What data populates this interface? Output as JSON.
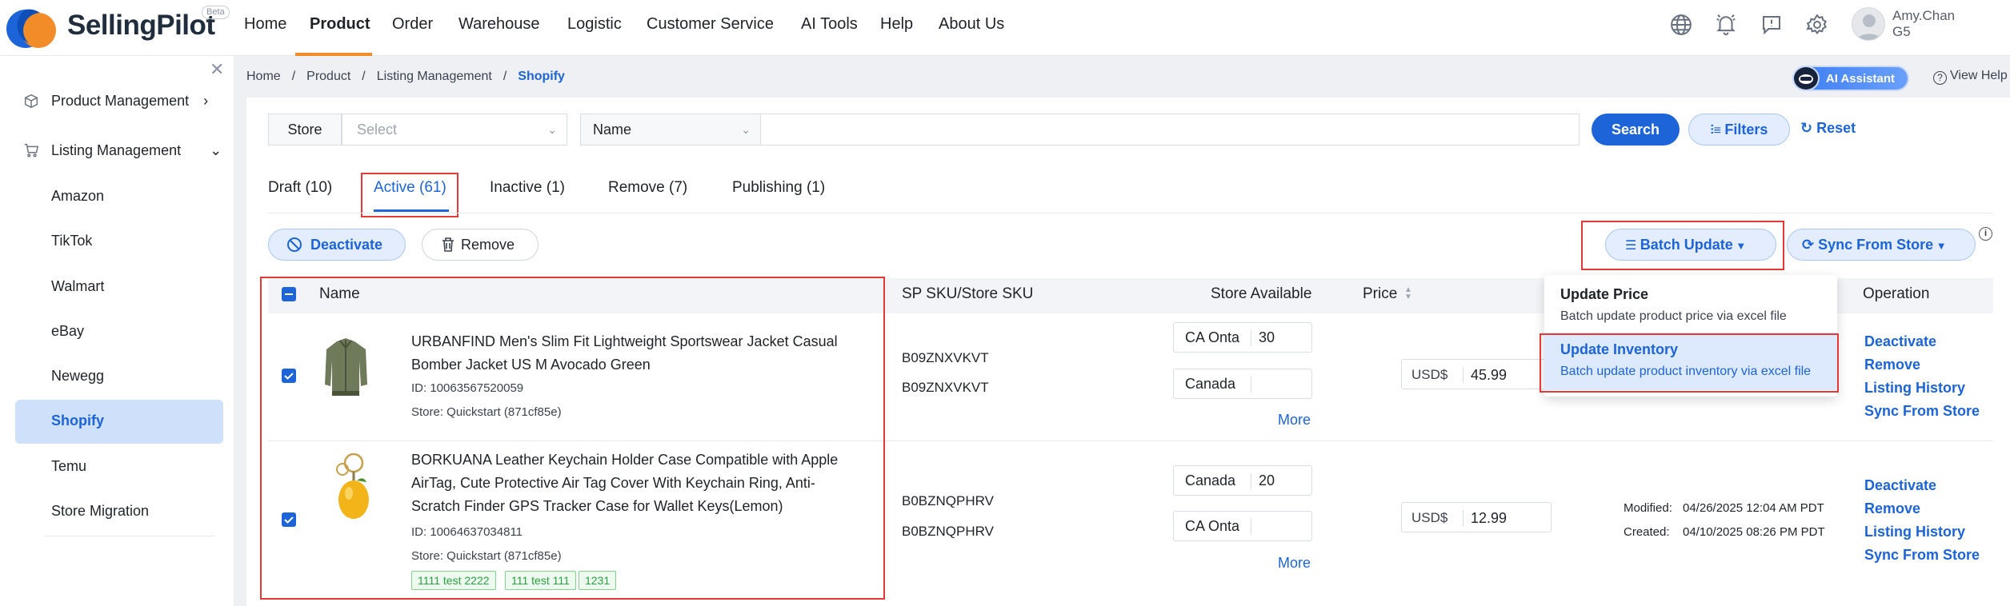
{
  "header": {
    "brand": "SellingPilot",
    "beta": "Beta",
    "nav": [
      "Home",
      "Product",
      "Order",
      "Warehouse",
      "Logistic",
      "Customer Service",
      "AI Tools",
      "Help",
      "About Us"
    ],
    "user_name": "Amy.Chan",
    "user_level": "G5"
  },
  "sidebar": {
    "product_management": "Product Management",
    "listing_management": "Listing Management",
    "items": [
      "Amazon",
      "TikTok",
      "Walmart",
      "eBay",
      "Newegg",
      "Shopify",
      "Temu",
      "Store Migration"
    ]
  },
  "breadcrumb": [
    "Home",
    "Product",
    "Listing Management",
    "Shopify"
  ],
  "ai_assistant": "AI Assistant",
  "view_help": "View Help",
  "filters": {
    "store_label": "Store",
    "store_placeholder": "Select",
    "field_select": "Name",
    "search_value": "",
    "search_button": "Search",
    "filters_button": "Filters",
    "reset_button": "Reset"
  },
  "tabs": [
    "Draft (10)",
    "Active (61)",
    "Inactive (1)",
    "Remove (7)",
    "Publishing (1)"
  ],
  "actions": {
    "deactivate": "Deactivate",
    "remove": "Remove",
    "batch_update": "Batch Update",
    "sync_from_store": "Sync From Store"
  },
  "batch_menu": {
    "price_title": "Update Price",
    "price_desc": "Batch update product price via excel file",
    "inventory_title": "Update Inventory",
    "inventory_desc": "Batch update product inventory via excel file"
  },
  "table": {
    "headers": [
      "Name",
      "SP SKU/Store SKU",
      "Store Available",
      "Price",
      "Operation"
    ],
    "rows": [
      {
        "title_line1": "URBANFIND Men's Slim Fit Lightweight Sportswear Jacket Casual",
        "title_line2": "Bomber Jacket US M Avocado Green",
        "id": "ID: 10063567520059",
        "store": "Store: Quickstart (871cf85e)",
        "sp_sku": "B09ZNXVKVT",
        "store_sku": "B09ZNXVKVT",
        "inv1_loc": "CA Onta",
        "inv1_qty": "30",
        "inv2_loc": "Canada",
        "inv2_qty": "",
        "more": "More",
        "currency": "USD$",
        "price": "45.99",
        "ops": [
          "Deactivate",
          "Remove",
          "Listing History",
          "Sync From Store"
        ]
      },
      {
        "title_line1": "BORKUANA Leather Keychain Holder Case Compatible with Apple",
        "title_line2": "AirTag, Cute Protective Air Tag Cover With Keychain Ring, Anti-",
        "title_line3": "Scratch Finder GPS Tracker Case for Wallet Keys(Lemon)",
        "id": "ID: 10064637034811",
        "store": "Store: Quickstart (871cf85e)",
        "tags": [
          "1111 test 2222",
          "111 test 111",
          "1231"
        ],
        "sp_sku": "B0BZNQPHRV",
        "store_sku": "B0BZNQPHRV",
        "inv1_loc": "Canada",
        "inv1_qty": "20",
        "inv2_loc": "CA Onta",
        "inv2_qty": "",
        "more": "More",
        "currency": "USD$",
        "price": "12.99",
        "modified_label": "Modified:",
        "modified": "04/26/2025 12:04 AM PDT",
        "created_label": "Created:",
        "created": "04/10/2025 08:26 PM PDT",
        "ops": [
          "Deactivate",
          "Remove",
          "Listing History",
          "Sync From Store"
        ]
      }
    ]
  },
  "colors": {
    "accent": "#1c64d8",
    "brand_orange": "#f28c28",
    "highlight_red": "#e53935",
    "tag_green": "#25a33c"
  }
}
